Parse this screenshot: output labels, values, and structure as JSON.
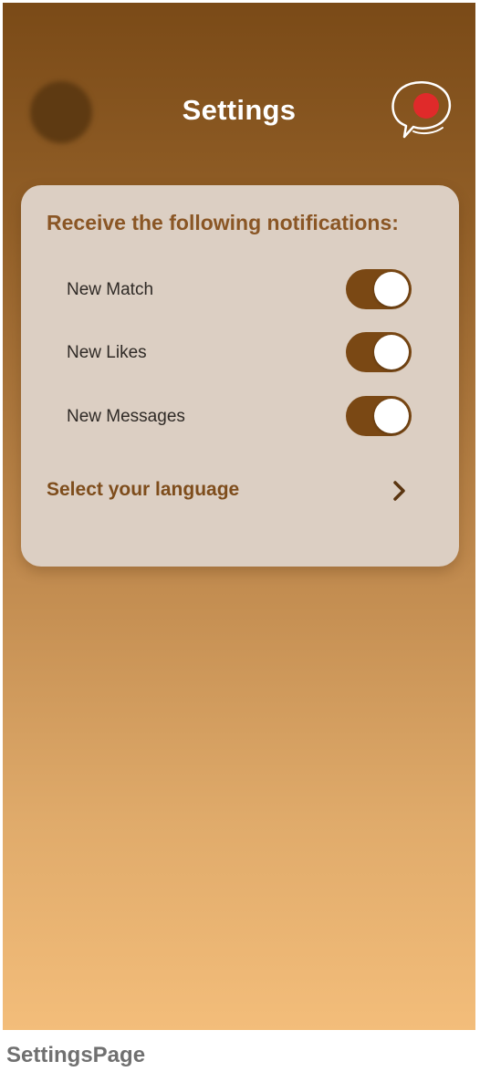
{
  "header": {
    "title": "Settings",
    "avatar_icon": "avatar-placeholder",
    "chat_icon": "chat-bubble-icon",
    "badge_color": "#e02a2a"
  },
  "notifications": {
    "heading": "Receive the following notifications:",
    "items": [
      {
        "label": "New Match",
        "enabled": true
      },
      {
        "label": "New Likes",
        "enabled": true
      },
      {
        "label": "New Messages",
        "enabled": true
      }
    ]
  },
  "language": {
    "label": "Select your language",
    "icon": "chevron-right-icon"
  },
  "colors": {
    "accent": "#7a4814",
    "heading": "#8a5625",
    "gradient_top": "#7a4a17",
    "gradient_bottom": "#f3bd7a"
  },
  "caption": "SettingsPage"
}
